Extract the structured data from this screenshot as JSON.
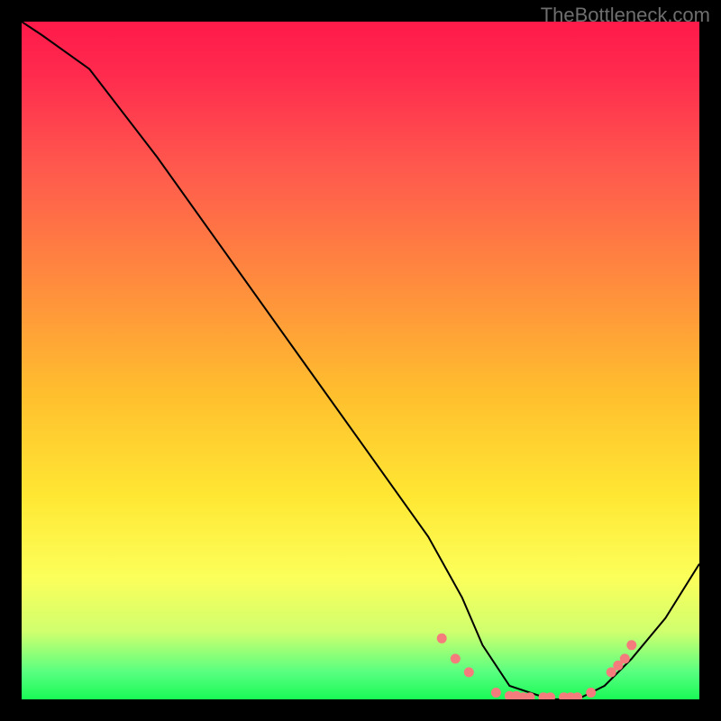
{
  "attribution": "TheBottleneck.com",
  "chart_data": {
    "type": "line",
    "title": "",
    "xlabel": "",
    "ylabel": "",
    "xlim": [
      0,
      100
    ],
    "ylim": [
      0,
      100
    ],
    "series": [
      {
        "name": "curve",
        "x": [
          0,
          3,
          10,
          20,
          30,
          40,
          50,
          60,
          65,
          68,
          72,
          78,
          82,
          86,
          90,
          95,
          100
        ],
        "y": [
          100,
          98,
          93,
          80,
          66,
          52,
          38,
          24,
          15,
          8,
          2,
          0,
          0,
          2,
          6,
          12,
          20
        ]
      }
    ],
    "markers": {
      "name": "highlighted-points",
      "color": "#f57c7c",
      "points": [
        {
          "x": 62,
          "y": 9
        },
        {
          "x": 64,
          "y": 6
        },
        {
          "x": 66,
          "y": 4
        },
        {
          "x": 70,
          "y": 1
        },
        {
          "x": 72,
          "y": 0.5
        },
        {
          "x": 73,
          "y": 0.5
        },
        {
          "x": 74,
          "y": 0.3
        },
        {
          "x": 75,
          "y": 0.3
        },
        {
          "x": 77,
          "y": 0.3
        },
        {
          "x": 78,
          "y": 0.3
        },
        {
          "x": 80,
          "y": 0.3
        },
        {
          "x": 81,
          "y": 0.3
        },
        {
          "x": 82,
          "y": 0.3
        },
        {
          "x": 84,
          "y": 1
        },
        {
          "x": 87,
          "y": 4
        },
        {
          "x": 88,
          "y": 5
        },
        {
          "x": 89,
          "y": 6
        },
        {
          "x": 90,
          "y": 8
        }
      ]
    },
    "grid": false,
    "legend": false
  }
}
